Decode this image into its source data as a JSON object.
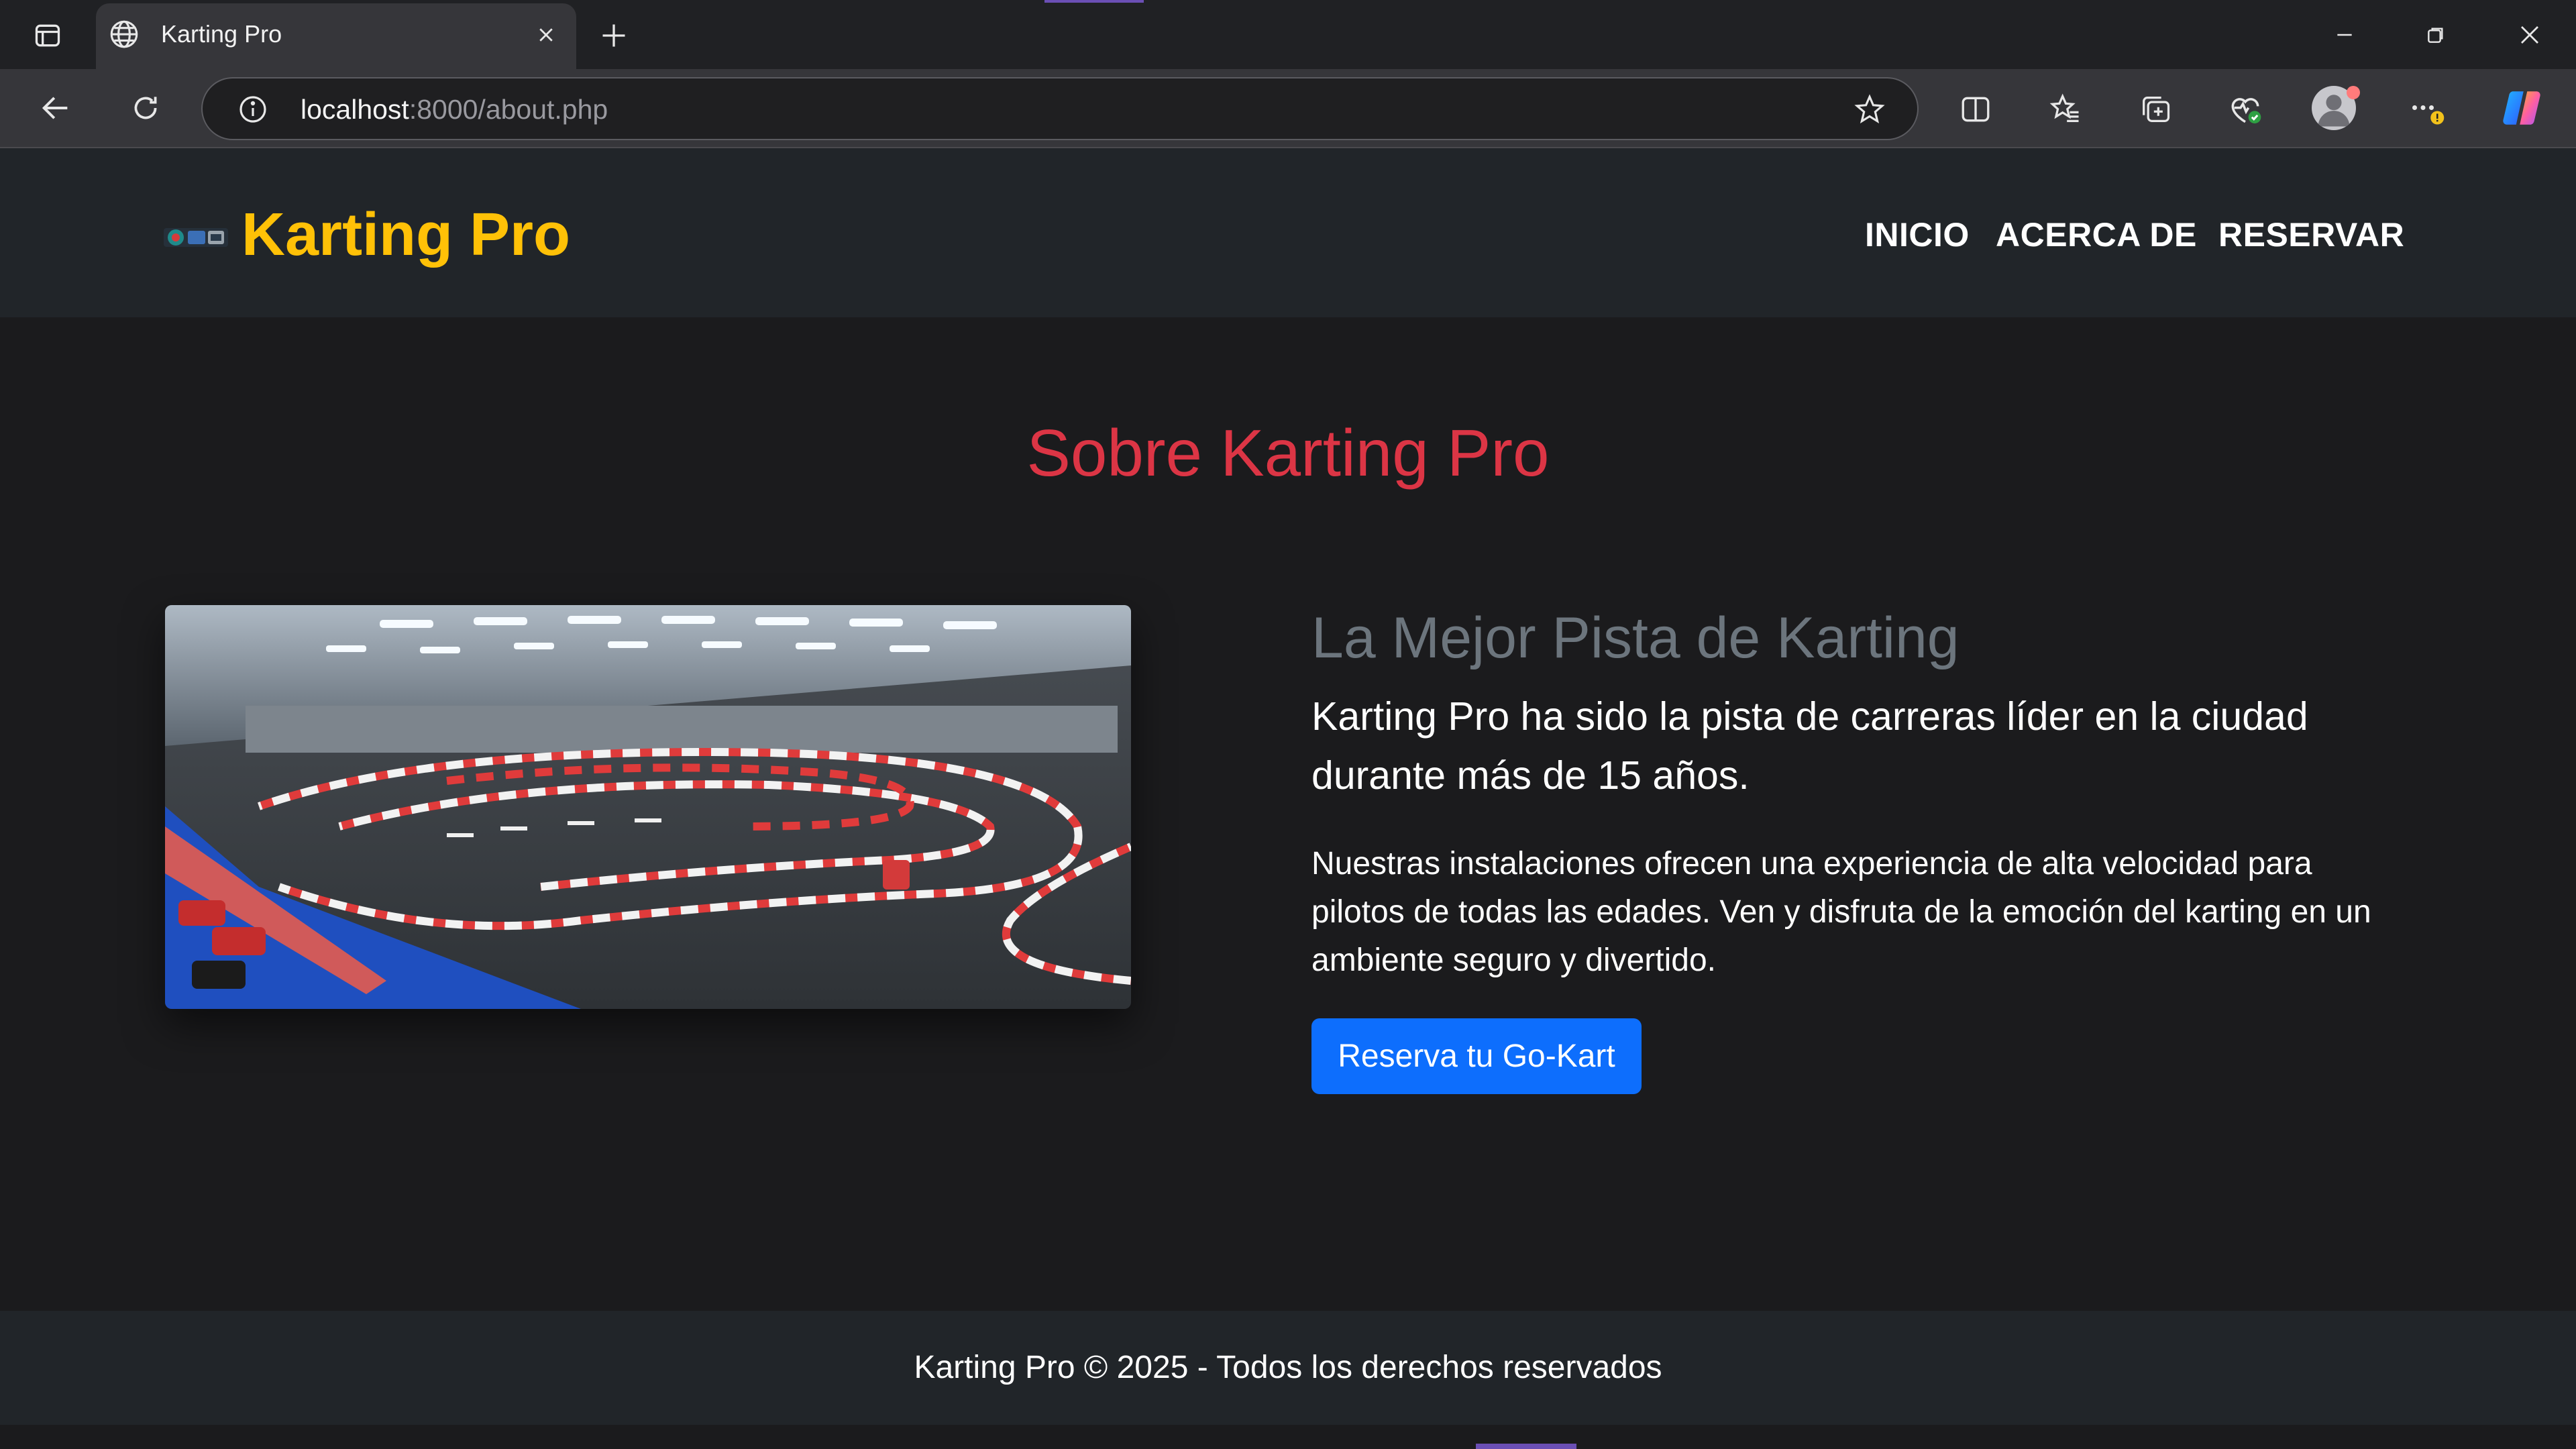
{
  "browser": {
    "tab_title": "Karting Pro",
    "url_host": "localhost",
    "url_path": ":8000/about.php",
    "icons": [
      "sidebar-toggle-icon",
      "globe-icon",
      "close-icon",
      "plus-icon",
      "minimize-icon",
      "restore-icon",
      "close-window-icon",
      "back-arrow-icon",
      "refresh-icon",
      "info-icon",
      "star-icon",
      "split-screen-icon",
      "favorites-icon",
      "collections-icon",
      "browser-essentials-icon",
      "profile-avatar",
      "more-options-icon",
      "copilot-icon"
    ]
  },
  "site": {
    "brand": "Karting Pro",
    "nav": [
      {
        "label": "INICIO"
      },
      {
        "label": "ACERCA DE"
      },
      {
        "label": "RESERVAR"
      }
    ]
  },
  "about": {
    "heading": "Sobre Karting Pro",
    "section_title": "La Mejor Pista de Karting",
    "lead": "Karting Pro ha sido la pista de carreras líder en la ciudad durante más de 15 años.",
    "body": "Nuestras instalaciones ofrecen una experiencia de alta velocidad para pilotos de todas las edades. Ven y disfruta de la emoción del karting en un ambiente seguro y divertido.",
    "cta_label": "Reserva tu Go-Kart"
  },
  "footer": {
    "text": "Karting Pro © 2025 - Todos los derechos reservados"
  },
  "colors": {
    "brand": "#ffc107",
    "heading": "#dc3545",
    "muted": "#6c757d",
    "primary_button": "#0d6efd",
    "header_bg": "#212529",
    "page_bg": "#1b1b1d"
  }
}
